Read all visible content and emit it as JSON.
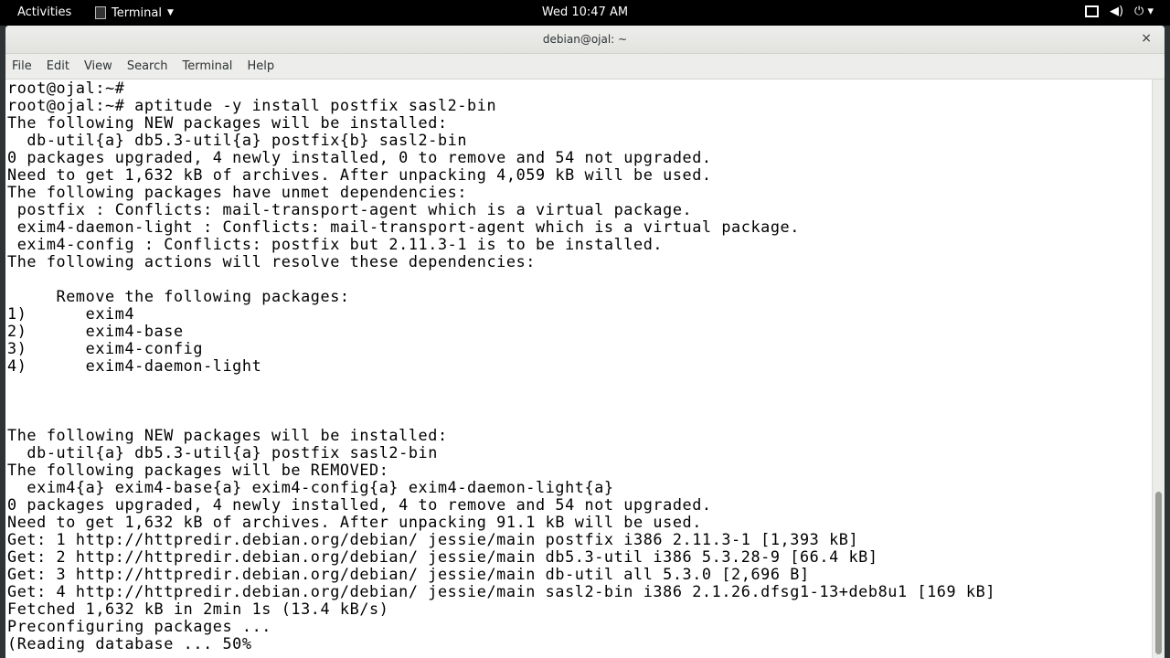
{
  "topbar": {
    "activities": "Activities",
    "app_menu": "Terminal",
    "clock": "Wed 10:47 AM"
  },
  "window": {
    "title": "debian@ojal: ~",
    "close": "×"
  },
  "menubar": [
    "File",
    "Edit",
    "View",
    "Search",
    "Terminal",
    "Help"
  ],
  "terminal_lines": [
    "root@ojal:~#",
    "root@ojal:~# aptitude -y install postfix sasl2-bin",
    "The following NEW packages will be installed:",
    "  db-util{a} db5.3-util{a} postfix{b} sasl2-bin",
    "0 packages upgraded, 4 newly installed, 0 to remove and 54 not upgraded.",
    "Need to get 1,632 kB of archives. After unpacking 4,059 kB will be used.",
    "The following packages have unmet dependencies:",
    " postfix : Conflicts: mail-transport-agent which is a virtual package.",
    " exim4-daemon-light : Conflicts: mail-transport-agent which is a virtual package.",
    " exim4-config : Conflicts: postfix but 2.11.3-1 is to be installed.",
    "The following actions will resolve these dependencies:",
    "",
    "     Remove the following packages:",
    "1)      exim4",
    "2)      exim4-base",
    "3)      exim4-config",
    "4)      exim4-daemon-light",
    "",
    "",
    "",
    "The following NEW packages will be installed:",
    "  db-util{a} db5.3-util{a} postfix sasl2-bin",
    "The following packages will be REMOVED:",
    "  exim4{a} exim4-base{a} exim4-config{a} exim4-daemon-light{a}",
    "0 packages upgraded, 4 newly installed, 4 to remove and 54 not upgraded.",
    "Need to get 1,632 kB of archives. After unpacking 91.1 kB will be used.",
    "Get: 1 http://httpredir.debian.org/debian/ jessie/main postfix i386 2.11.3-1 [1,393 kB]",
    "Get: 2 http://httpredir.debian.org/debian/ jessie/main db5.3-util i386 5.3.28-9 [66.4 kB]",
    "Get: 3 http://httpredir.debian.org/debian/ jessie/main db-util all 5.3.0 [2,696 B]",
    "Get: 4 http://httpredir.debian.org/debian/ jessie/main sasl2-bin i386 2.1.26.dfsg1-13+deb8u1 [169 kB]",
    "Fetched 1,632 kB in 2min 1s (13.4 kB/s)",
    "Preconfiguring packages ...",
    "(Reading database ... 50%"
  ]
}
